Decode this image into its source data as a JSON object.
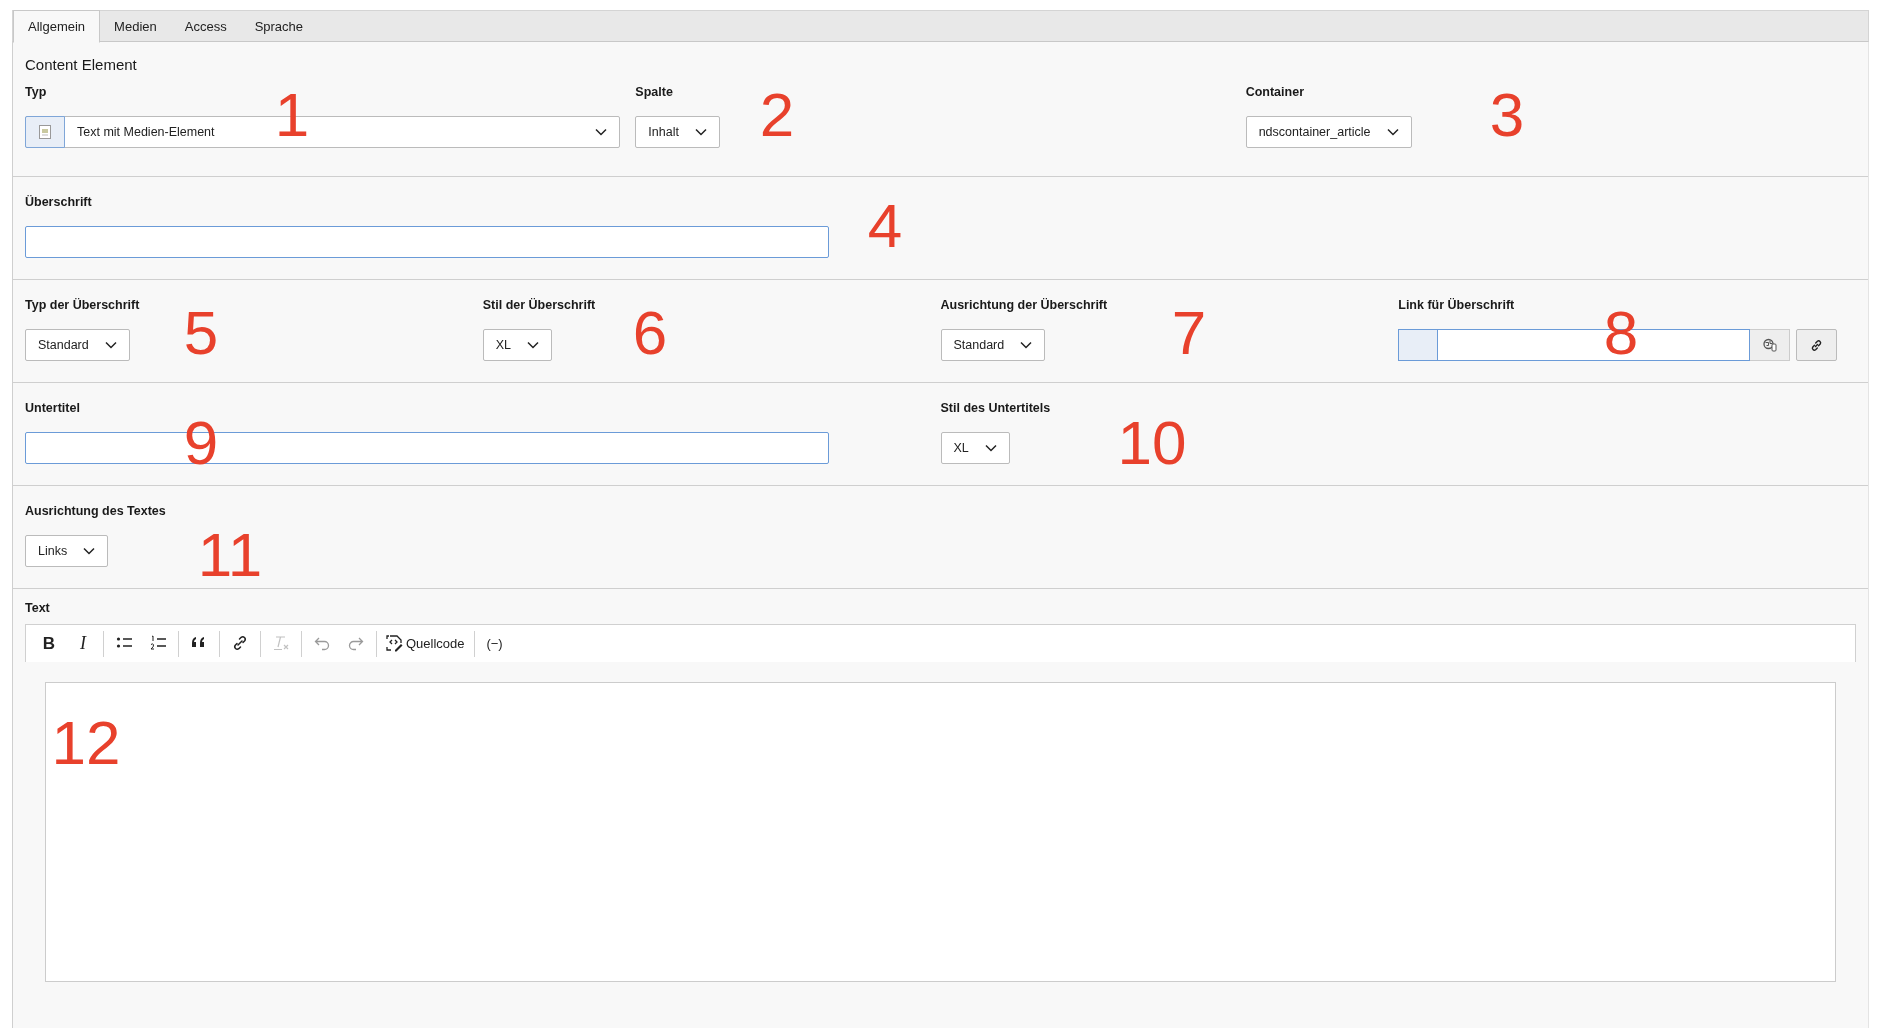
{
  "tabs": [
    {
      "label": "Allgemein",
      "selected": true
    },
    {
      "label": "Medien",
      "selected": false
    },
    {
      "label": "Access",
      "selected": false
    },
    {
      "label": "Sprache",
      "selected": false
    }
  ],
  "sections": [
    {
      "title": "Content Element",
      "fields": [
        {
          "kind": "icon-select",
          "label": "Typ",
          "value": "Text mit Medien-Element"
        },
        {
          "kind": "select",
          "label": "Spalte",
          "value": "Inhalt"
        },
        {
          "kind": "select",
          "label": "Container",
          "value": "ndscontainer_article"
        }
      ]
    },
    {
      "fields": [
        {
          "kind": "input",
          "label": "Überschrift"
        }
      ]
    },
    {
      "fields": [
        {
          "kind": "select",
          "label": "Typ der Überschrift",
          "value": "Standard"
        },
        {
          "kind": "select",
          "label": "Stil der Überschrift",
          "value": "XL"
        },
        {
          "kind": "select",
          "label": "Ausrichtung der Überschrift",
          "value": "Standard"
        },
        {
          "kind": "link",
          "label": "Link für Überschrift"
        }
      ]
    },
    {
      "fields": [
        {
          "kind": "input",
          "label": "Untertitel"
        },
        {
          "kind": "select",
          "label": "Stil des Untertitels",
          "value": "XL"
        }
      ]
    },
    {
      "fields": [
        {
          "kind": "select",
          "label": "Ausrichtung des Textes",
          "value": "Links"
        }
      ]
    }
  ],
  "editor": {
    "label": "Text",
    "toolbar": [
      {
        "kind": "bold",
        "glyph": "B",
        "disabled": false
      },
      {
        "kind": "italic",
        "glyph": "I",
        "disabled": false
      },
      {
        "kind": "separator"
      },
      {
        "kind": "bulleted-list",
        "disabled": false
      },
      {
        "kind": "numbered-list",
        "disabled": false
      },
      {
        "kind": "separator"
      },
      {
        "kind": "quote",
        "disabled": false
      },
      {
        "kind": "separator"
      },
      {
        "kind": "link",
        "disabled": false
      },
      {
        "kind": "separator"
      },
      {
        "kind": "remove-format",
        "disabled": true
      },
      {
        "kind": "separator"
      },
      {
        "kind": "undo",
        "disabled": true
      },
      {
        "kind": "redo",
        "disabled": true
      },
      {
        "kind": "separator"
      },
      {
        "kind": "source",
        "label": "Quellcode",
        "disabled": false
      },
      {
        "kind": "separator"
      },
      {
        "kind": "show-blocks",
        "glyph": "(−)",
        "disabled": false
      }
    ]
  },
  "annotations": [
    "1",
    "2",
    "3",
    "4",
    "5",
    "6",
    "7",
    "8",
    "9",
    "10",
    "11",
    "12"
  ]
}
